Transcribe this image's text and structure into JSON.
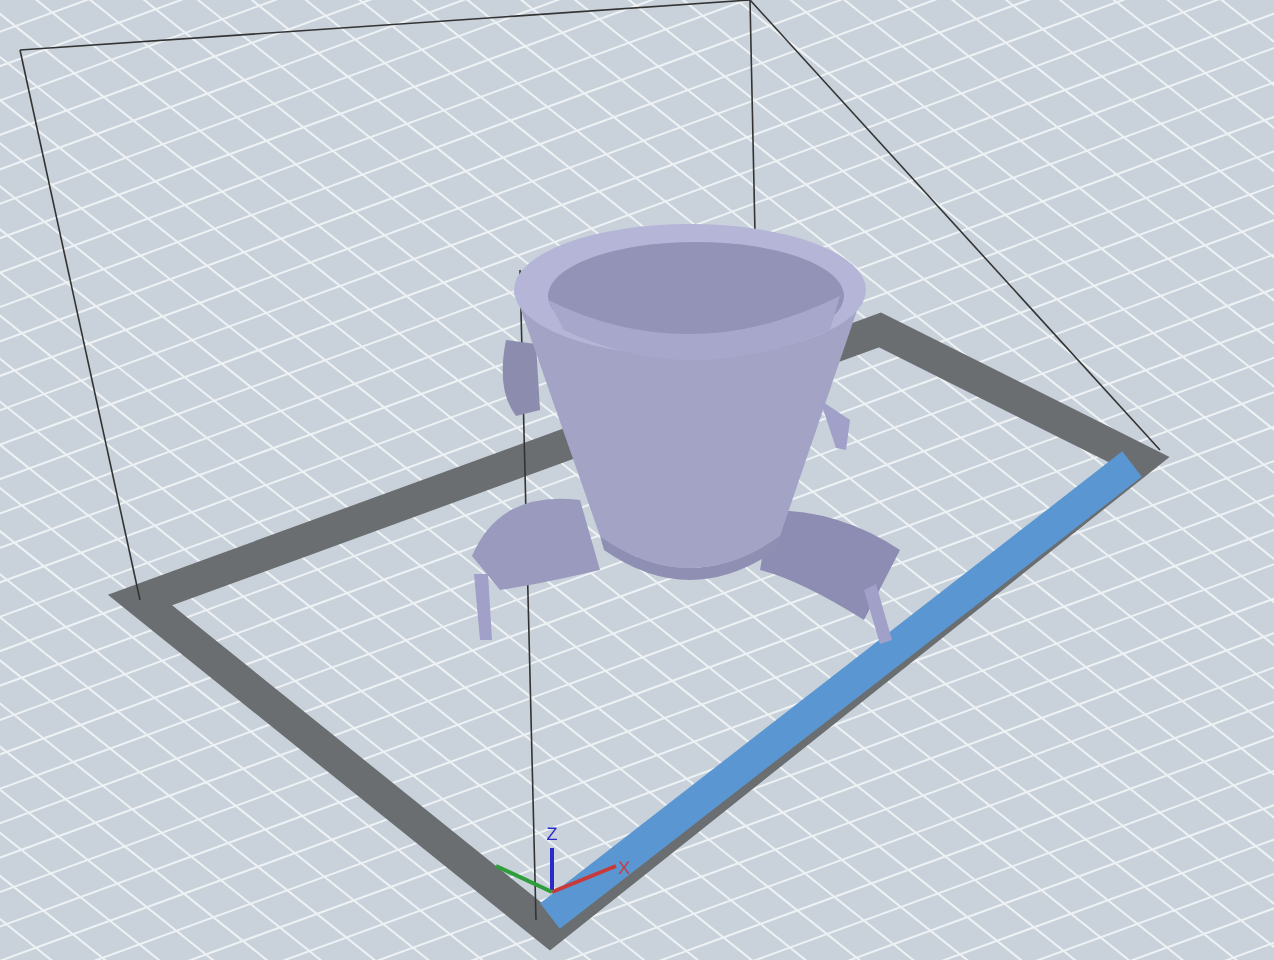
{
  "viewport": {
    "axes": [
      {
        "kind": "z",
        "label": "Z",
        "color": "#2a2ac8"
      },
      {
        "kind": "x",
        "label": "X",
        "color": "#c83a3a"
      },
      {
        "kind": "y",
        "color": "#2f9e3a"
      }
    ]
  }
}
